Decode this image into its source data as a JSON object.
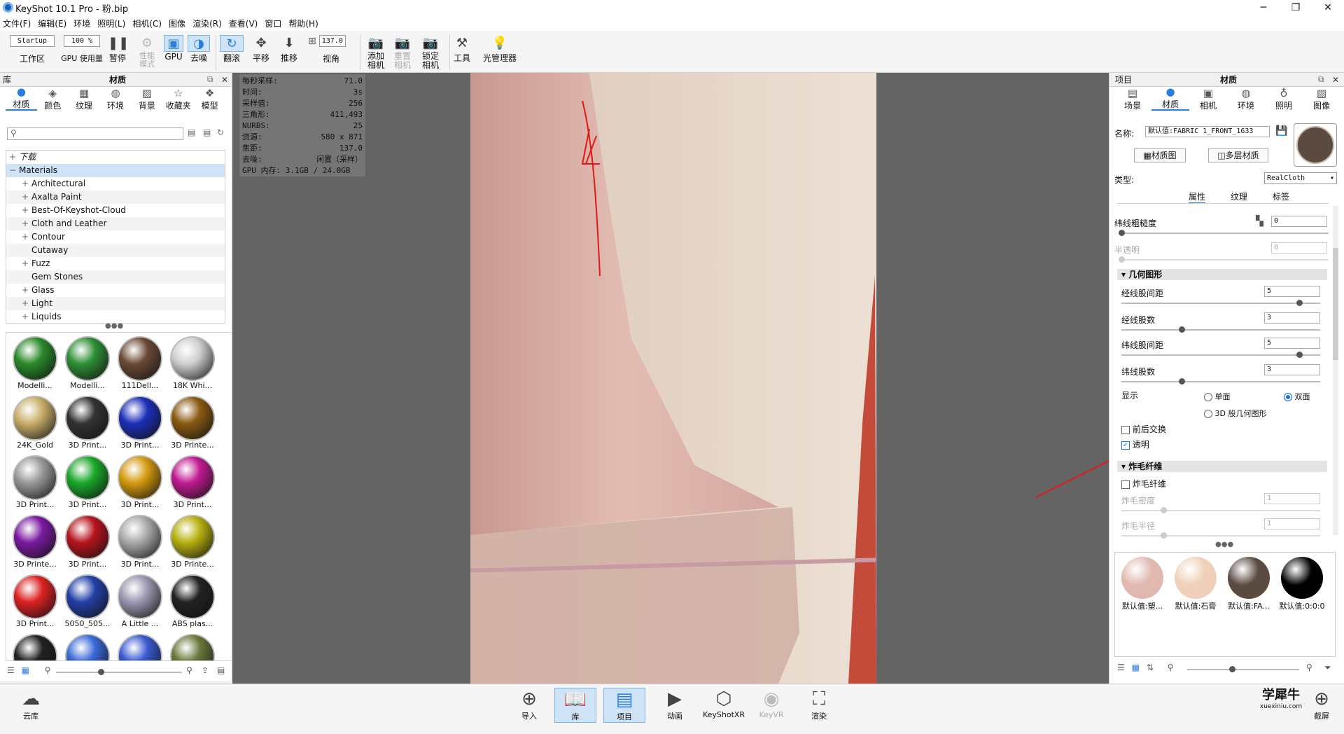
{
  "window": {
    "title": "KeyShot 10.1 Pro  - 粉.bip",
    "minimize": "─",
    "restore": "❐",
    "close": "✕"
  },
  "menu": [
    "文件(F)",
    "编辑(E)",
    "环境",
    "照明(L)",
    "相机(C)",
    "图像",
    "渲染(R)",
    "查看(V)",
    "窗口",
    "帮助(H)"
  ],
  "toolbar": {
    "workspace_value": "Startup",
    "workspace_label": "工作区",
    "gpu_pct": "100 %",
    "gpu_label": "GPU 使用量",
    "pause": "暂停",
    "perf": "性能\n模式",
    "gpu": "GPU",
    "denoise": "去噪",
    "tumble": "翻滚",
    "pan": "平移",
    "dolly": "推移",
    "fov_value": "137.0",
    "fov_label": "视角",
    "add_cam": "添加\n相机",
    "reset_cam": "重置\n相机",
    "lock_cam": "锁定\n相机",
    "tools": "工具",
    "light_mgr": "光管理器"
  },
  "library": {
    "title": "库",
    "panel_title": "材质",
    "tabs": [
      "材质",
      "颜色",
      "纹理",
      "环境",
      "背景",
      "收藏夹",
      "模型"
    ],
    "search_placeholder": "",
    "tree": [
      "下载",
      "Materials",
      "Architectural",
      "Axalta Paint",
      "Best-Of-Keyshot-Cloud",
      "Cloth and Leather",
      "Contour",
      "Cutaway",
      "Fuzz",
      "Gem Stones",
      "Glass",
      "Light",
      "Liquids"
    ],
    "thumbs": [
      {
        "l": "Modelli...",
        "c": "#2a8a2a"
      },
      {
        "l": "Modelli...",
        "c": "#2e8f35"
      },
      {
        "l": "111Dell...",
        "c": "#6b4a36"
      },
      {
        "l": "18K Whi...",
        "c": "#cfcfcf"
      },
      {
        "l": "24K_Gold",
        "c": "#c9ae6a"
      },
      {
        "l": "3D Print...",
        "c": "#333"
      },
      {
        "l": "3D Print...",
        "c": "#1c2fb8"
      },
      {
        "l": "3D Printe...",
        "c": "#8a5a10"
      },
      {
        "l": "3D Print...",
        "c": "#999"
      },
      {
        "l": "3D Print...",
        "c": "#1aa82a"
      },
      {
        "l": "3D Print...",
        "c": "#d49a10"
      },
      {
        "l": "3D Print...",
        "c": "#c01a90"
      },
      {
        "l": "3D Printe...",
        "c": "#7a1aa0"
      },
      {
        "l": "3D Print...",
        "c": "#b8141e"
      },
      {
        "l": "3D Print...",
        "c": "#aaa"
      },
      {
        "l": "3D Printe...",
        "c": "#b8b010"
      },
      {
        "l": "3D Print...",
        "c": "#d22"
      },
      {
        "l": "5050_505...",
        "c": "#2340a8"
      },
      {
        "l": "A Little ...",
        "c": "#9a98b0"
      },
      {
        "l": "ABS plas...",
        "c": "#222"
      },
      {
        "l": "",
        "c": "#222"
      },
      {
        "l": "",
        "c": "#3a6ad8"
      },
      {
        "l": "",
        "c": "#3a5ad0"
      },
      {
        "l": "",
        "c": "#6a7a3a"
      }
    ]
  },
  "hud": [
    [
      "每秒采样:",
      "71.0"
    ],
    [
      "时间:",
      "3s"
    ],
    [
      "采样值:",
      "256"
    ],
    [
      "三角形:",
      "411,493"
    ],
    [
      "NURBS:",
      "25"
    ],
    [
      "资源:",
      "580 x 871"
    ],
    [
      "焦距:",
      "137.0"
    ],
    [
      "去噪:",
      "闲置（采样）"
    ],
    [
      "GPU 内存: 3.1GB / 24.0GB",
      ""
    ]
  ],
  "project": {
    "title": "项目",
    "panel_title": "材质",
    "tabs": [
      "场景",
      "材质",
      "相机",
      "环境",
      "照明",
      "图像"
    ],
    "name_label": "名称:",
    "name_value": "默认值:FABRIC 1_FRONT_1633",
    "graph_btn": "材质图",
    "multi_btn": "多层材质",
    "type_label": "类型:",
    "type_value": "RealCloth",
    "subtabs": [
      "属性",
      "纹理",
      "标签"
    ],
    "weft_rough_label": "纬线粗糙度",
    "weft_rough_value": "0",
    "translucency_label": "半透明",
    "translucency_value": "0",
    "geom_section": "几何图形",
    "warp_spacing_label": "经线股间距",
    "warp_spacing_value": "5",
    "warp_count_label": "经线股数",
    "warp_count_value": "3",
    "weft_spacing_label": "纬线股间距",
    "weft_spacing_value": "5",
    "weft_count_label": "纬线股数",
    "weft_count_value": "3",
    "display_label": "显示",
    "single": "单面",
    "double": "双面",
    "geom3d": "3D 股几何图形",
    "swap_label": "前后交换",
    "transparent_label": "透明",
    "fuzz_section": "炸毛纤维",
    "fuzz_check": "炸毛纤维",
    "fuzz_density_label": "炸毛密度",
    "fuzz_density_value": "1",
    "fuzz_radius_label": "炸毛半径",
    "fuzz_radius_value": "1",
    "swatches": [
      {
        "l": "默认值:塑...",
        "c": "#e0b8b0"
      },
      {
        "l": "默认值:石膏",
        "c": "#f0d0b8"
      },
      {
        "l": "默认值:FA...",
        "c": "#5a4a40"
      },
      {
        "l": "默认值:0:0:0",
        "c": "#000"
      }
    ]
  },
  "bottom": {
    "cloud": "云库",
    "import": "导入",
    "library": "库",
    "project": "项目",
    "animation": "动画",
    "keyshotxr": "KeyShotXR",
    "keyvr": "KeyVR",
    "render": "渲染",
    "screenshot": "截屏",
    "watermark": "学犀牛",
    "watermark_url": "xuexiniu.com"
  }
}
